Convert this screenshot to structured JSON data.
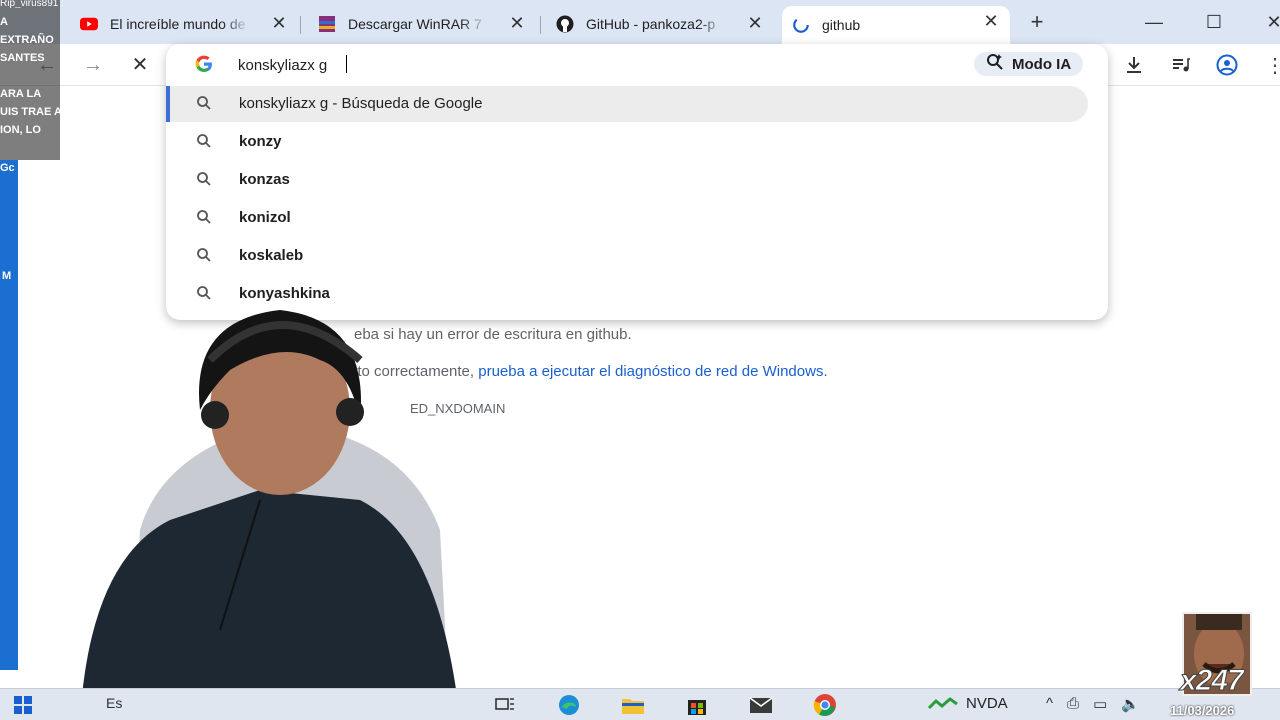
{
  "tabs": [
    {
      "title": "El increíble mundo de",
      "favicon": "youtube-icon"
    },
    {
      "title": "Descargar WinRAR 7",
      "favicon": "winrar-icon"
    },
    {
      "title": "GitHub - pankoza2-p",
      "favicon": "github-icon"
    },
    {
      "title": "github",
      "favicon": "loading-icon",
      "active": true
    }
  ],
  "omnibox": {
    "input_value": "konskyliazx g",
    "modo_ia_label": "Modo IA",
    "suggestions": [
      {
        "text": "konskyliazx g - Búsqueda de Google",
        "selected": true
      },
      {
        "text": "konzy"
      },
      {
        "text": "konzas"
      },
      {
        "text": "konizol"
      },
      {
        "text": "koskaleb"
      },
      {
        "text": "konyashkina"
      }
    ]
  },
  "page": {
    "line1": "eba si hay un error de escritura en github.",
    "line2_prefix": "ito correctamente,",
    "line2_link": "prueba a ejecutar el diagnóstico de red de Windows.",
    "error_code": "ED_NXDOMAIN"
  },
  "overlay": {
    "top_text": "Rip_virus891 :",
    "lines": [
      "A",
      "EXTRAÑO",
      "SANTES",
      "ARA LA",
      "UIS TRAE A",
      "ION, LO"
    ],
    "side_labels": [
      "Gc",
      "M"
    ]
  },
  "taskbar": {
    "search_text": "Es",
    "nvda_label": "NVDA",
    "date": "11/03/2026"
  },
  "cam": {
    "label": "x247"
  },
  "colors": {
    "accent": "#3d6fd6",
    "link": "#1a5fd0",
    "tabstrip": "#dbe5f4",
    "desktop": "#1e6fc9"
  }
}
